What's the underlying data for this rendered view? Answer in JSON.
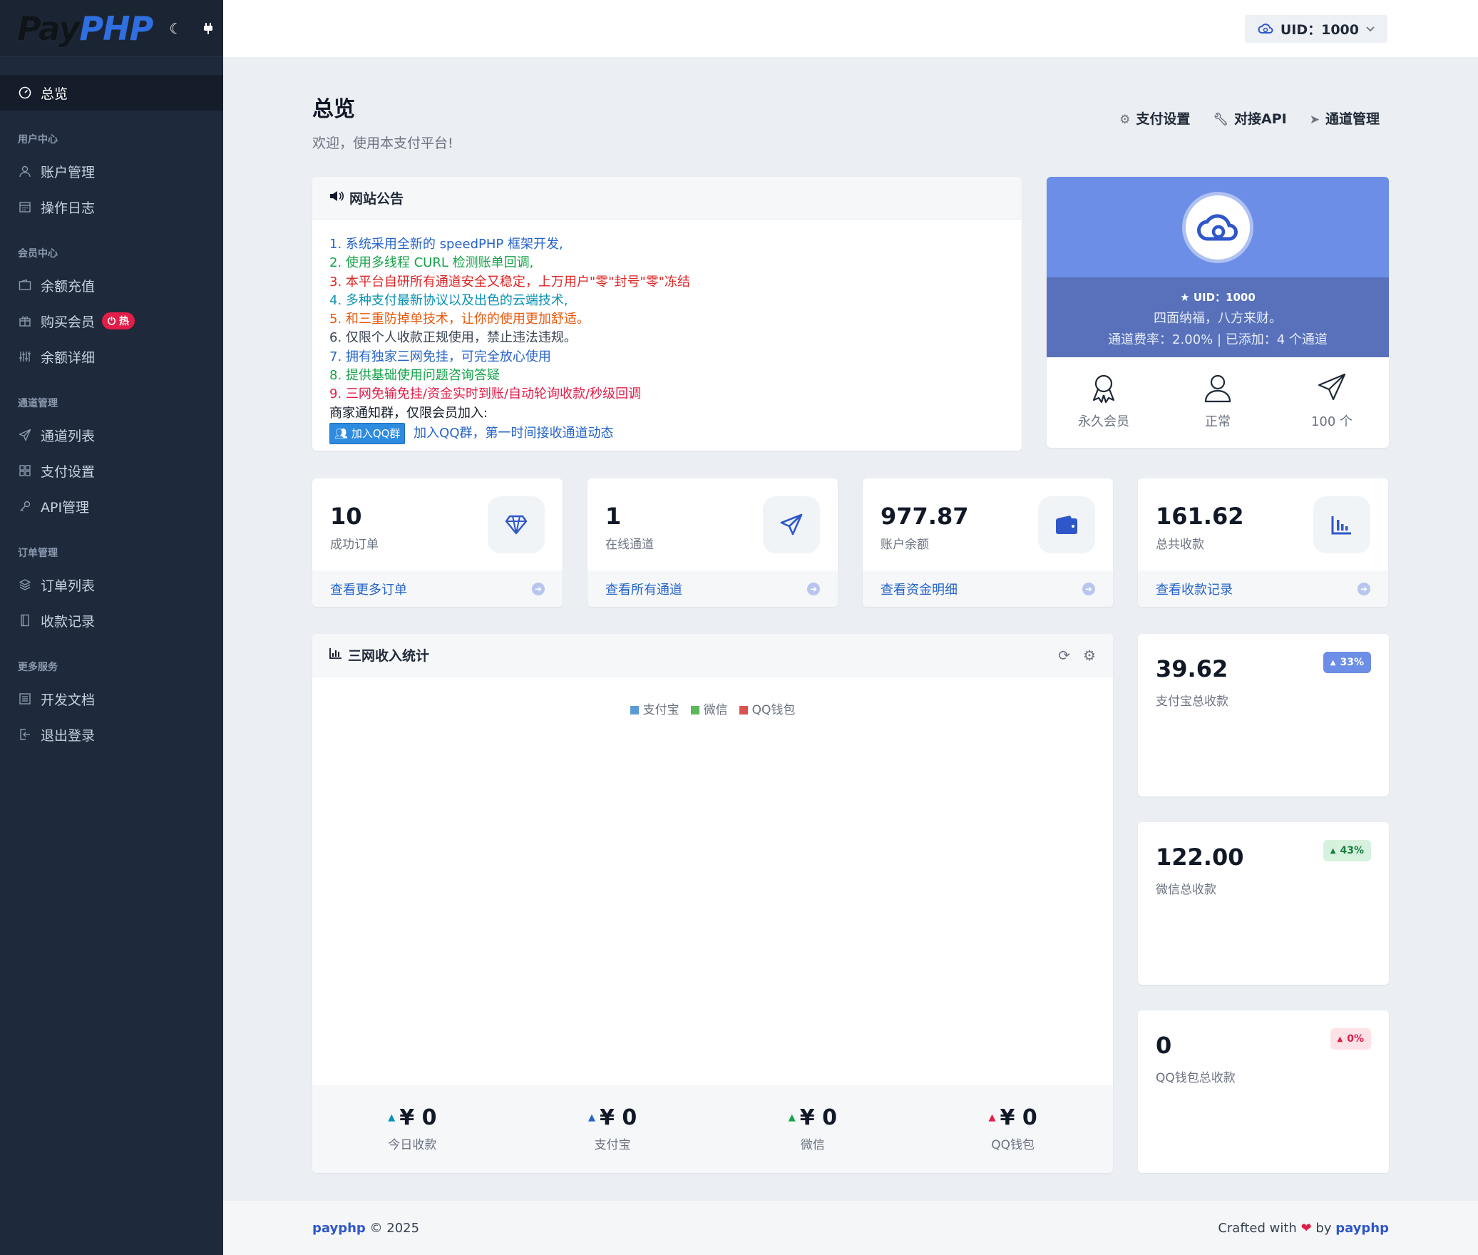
{
  "brand": {
    "pay": "Pay",
    "php": "PHP",
    "theme_icon": "moon-icon",
    "plugin_icon": "plug-icon"
  },
  "sidebar": {
    "active": {
      "label": "总览",
      "icon": "dashboard-icon"
    },
    "sections": [
      {
        "title": "用户中心",
        "items": [
          {
            "label": "账户管理",
            "icon": "user-icon"
          },
          {
            "label": "操作日志",
            "icon": "calendar-icon"
          }
        ]
      },
      {
        "title": "会员中心",
        "items": [
          {
            "label": "余额充值",
            "icon": "wallet-icon"
          },
          {
            "label": "购买会员",
            "icon": "gift-icon",
            "badge": "热"
          },
          {
            "label": "余额详细",
            "icon": "sliders-icon"
          }
        ]
      },
      {
        "title": "通道管理",
        "items": [
          {
            "label": "通道列表",
            "icon": "send-icon"
          },
          {
            "label": "支付设置",
            "icon": "grid-icon"
          },
          {
            "label": "API管理",
            "icon": "key-icon"
          }
        ]
      },
      {
        "title": "订单管理",
        "items": [
          {
            "label": "订单列表",
            "icon": "layers-icon"
          },
          {
            "label": "收款记录",
            "icon": "book-icon"
          }
        ]
      },
      {
        "title": "更多服务",
        "items": [
          {
            "label": "开发文档",
            "icon": "list-icon"
          },
          {
            "label": "退出登录",
            "icon": "logout-icon"
          }
        ]
      }
    ]
  },
  "topbar": {
    "uid_label": "UID：1000"
  },
  "page": {
    "title": "总览",
    "subtitle": "欢迎，使用本支付平台!",
    "links": [
      {
        "label": "支付设置",
        "icon": "gears-icon"
      },
      {
        "label": "对接API",
        "icon": "wrench-icon"
      },
      {
        "label": "通道管理",
        "icon": "paper-plane-icon"
      }
    ]
  },
  "notice": {
    "title": "网站公告",
    "lines": [
      "1. 系统采用全新的 speedPHP 框架开发,",
      "2. 使用多线程 CURL 检测账单回调,",
      "3. 本平台自研所有通道安全又稳定，上万用户\"零\"封号\"零\"冻结",
      "4. 多种支付最新协议以及出色的云端技术,",
      "5. 和三重防掉单技术，让你的使用更加舒适。",
      "6. 仅限个人收款正规使用，禁止违法违规。",
      "7. 拥有独家三网免挂，可完全放心使用",
      "8. 提供基础使用问题咨询答疑",
      "9. 三网免输免挂/资金实时到账/自动轮询收款/秒级回调",
      "商家通知群，仅限会员加入:"
    ],
    "qq_button": "加入QQ群",
    "qq_text": "加入QQ群，第一时间接收通道动态"
  },
  "profile": {
    "uid": "UID：1000",
    "motto": "四面纳福，八方来财。",
    "rate_text": "通道费率：2.00% | 已添加：4 个通道",
    "stats": [
      {
        "label": "永久会员",
        "icon": "award-icon"
      },
      {
        "label": "正常",
        "icon": "user-outline-icon"
      },
      {
        "label": "100 个",
        "icon": "send-outline-icon"
      }
    ]
  },
  "stats": [
    {
      "value": "10",
      "label": "成功订单",
      "link": "查看更多订单",
      "icon": "diamond-icon"
    },
    {
      "value": "1",
      "label": "在线通道",
      "link": "查看所有通道",
      "icon": "paper-plane-icon"
    },
    {
      "value": "977.87",
      "label": "账户余额",
      "link": "查看资金明细",
      "icon": "wallet-icon"
    },
    {
      "value": "161.62",
      "label": "总共收款",
      "link": "查看收款记录",
      "icon": "bar-chart-icon"
    }
  ],
  "income_chart": {
    "title": "三网收入统计",
    "legend": [
      {
        "name": "支付宝",
        "color": "#5b9bd5"
      },
      {
        "name": "微信",
        "color": "#5cb85c"
      },
      {
        "name": "QQ钱包",
        "color": "#d9534f"
      }
    ],
    "summary": [
      {
        "value": "¥ 0",
        "label": "今日收款",
        "color": "#0891b2"
      },
      {
        "value": "¥ 0",
        "label": "支付宝",
        "color": "#2563c9"
      },
      {
        "value": "¥ 0",
        "label": "微信",
        "color": "#16a34a"
      },
      {
        "value": "¥ 0",
        "label": "QQ钱包",
        "color": "#e11d48"
      }
    ]
  },
  "totals": [
    {
      "value": "39.62",
      "label": "支付宝总收款",
      "percent": "33%"
    },
    {
      "value": "122.00",
      "label": "微信总收款",
      "percent": "43%"
    },
    {
      "value": "0",
      "label": "QQ钱包总收款",
      "percent": "0%"
    }
  ],
  "footer": {
    "brand": "payphp",
    "copy": "© 2025",
    "crafted": "Crafted with",
    "by": "by",
    "author": "payphp"
  }
}
